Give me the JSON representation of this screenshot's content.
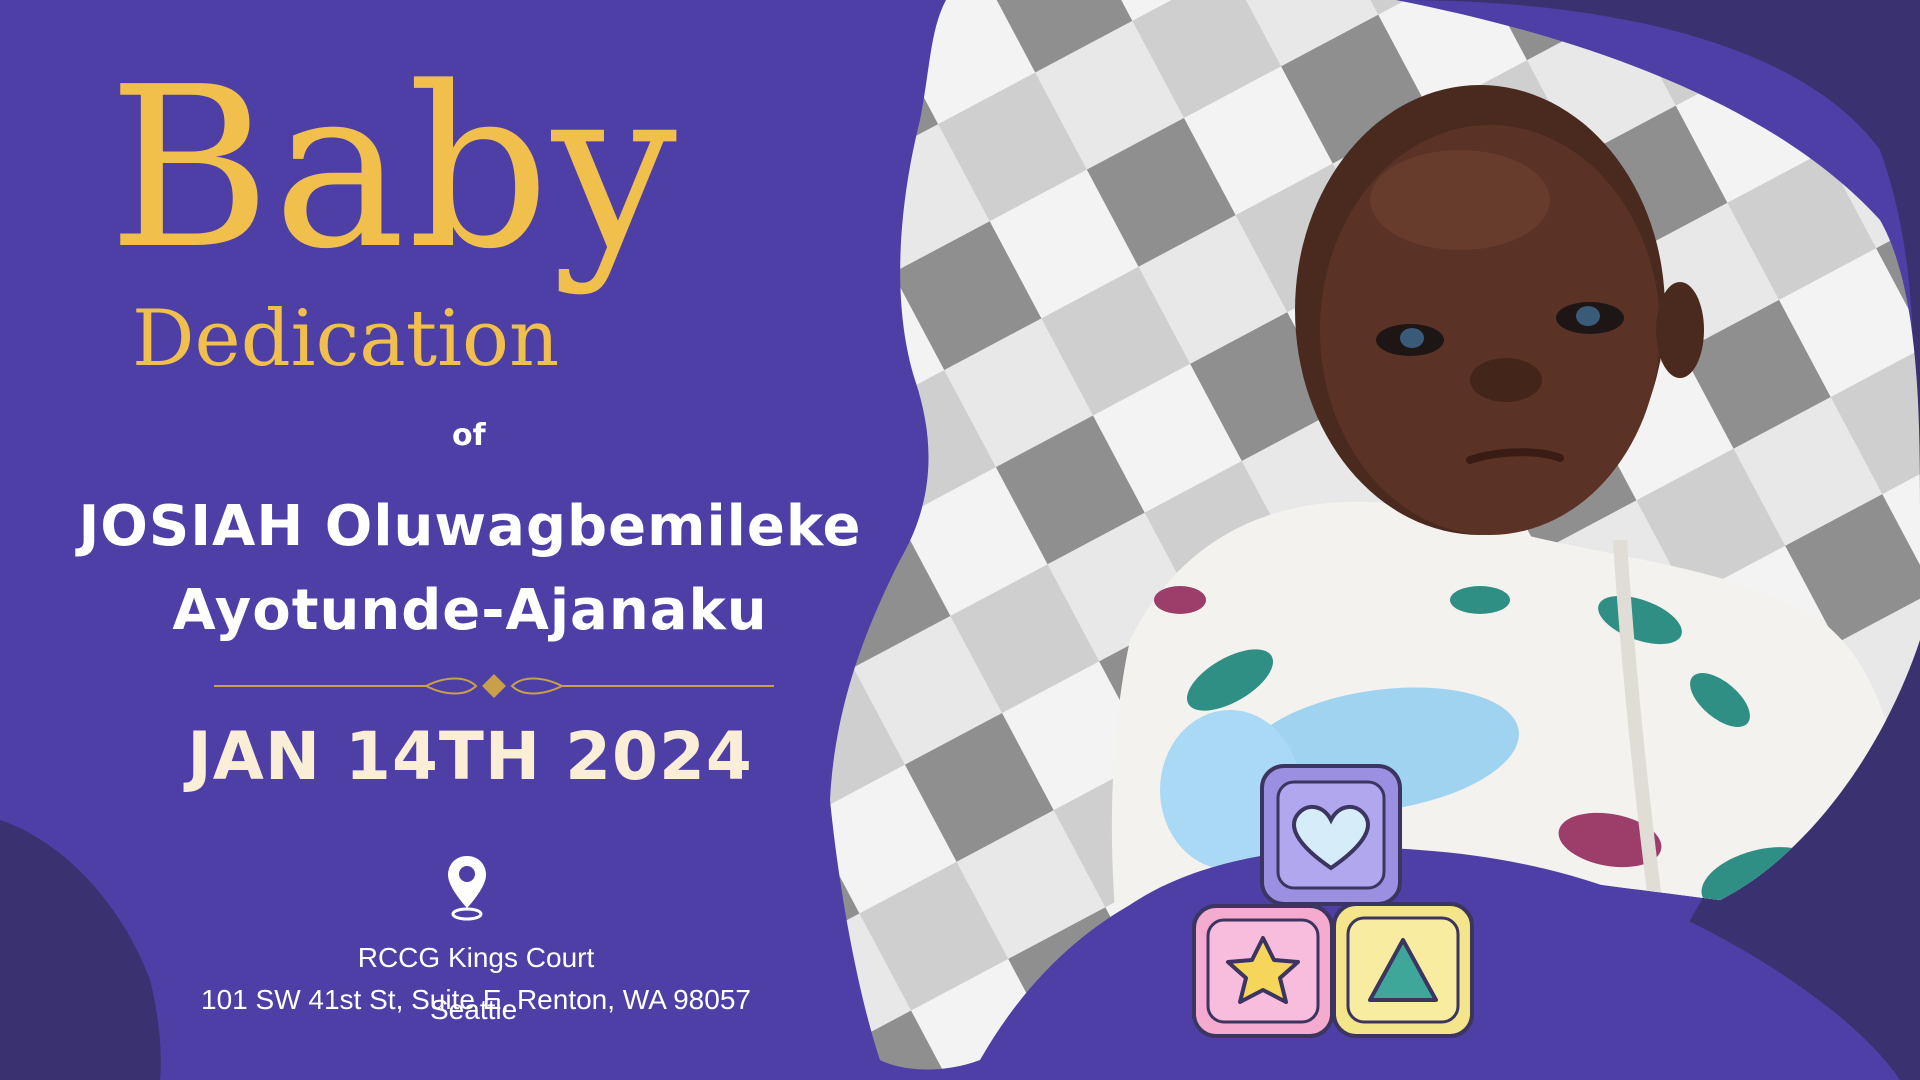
{
  "invitation": {
    "title_main": "Baby",
    "title_sub": "Dedication",
    "connector": "of",
    "name_line_1": "JOSIAH Oluwagbemileke",
    "name_line_2": "Ayotunde-Ajanaku",
    "date": "JAN 14TH 2024"
  },
  "venue": {
    "name": "RCCG Kings Court",
    "address": "101 SW 41st St, Suite E, Renton, WA 98057",
    "city": "Seattle"
  },
  "icons": {
    "location": "map-pin-icon",
    "decoration": "toy-blocks-icon",
    "divider": "ornamental-divider"
  },
  "colors": {
    "background_purple": "#4d3fa6",
    "dark_purple": "#3a3170",
    "gold": "#f0bf4c",
    "date_cream": "#fbeed6",
    "white": "#ffffff"
  },
  "photo": {
    "subject": "baby lying on a checkered blanket wearing a white dinosaur-print sleeper and light blue mittens"
  }
}
